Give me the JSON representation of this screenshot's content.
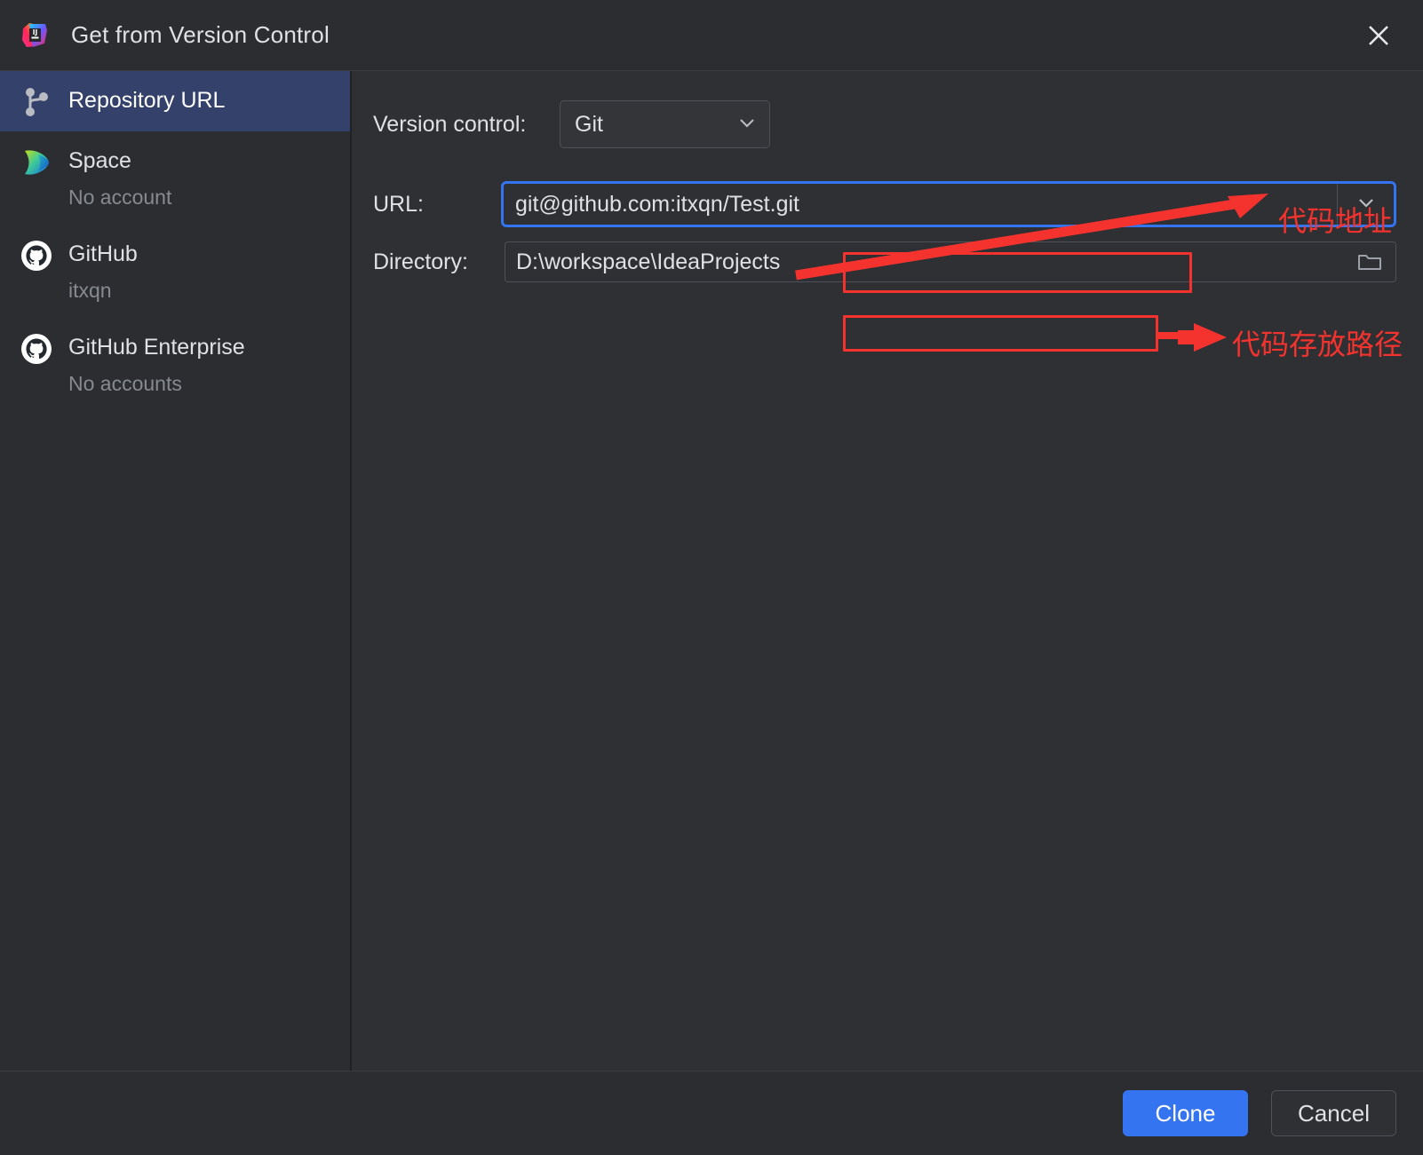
{
  "window": {
    "title": "Get from Version Control",
    "logo_icon": "intellij-idea-logo",
    "close_icon": "close-icon"
  },
  "sidebar": {
    "items": [
      {
        "label": "Repository URL",
        "sub": "",
        "icon": "git-branch-icon",
        "selected": true
      },
      {
        "label": "Space",
        "sub": "No account",
        "icon": "jetbrains-space-icon",
        "selected": false
      },
      {
        "label": "GitHub",
        "sub": "itxqn",
        "icon": "github-icon",
        "selected": false
      },
      {
        "label": "GitHub Enterprise",
        "sub": "No accounts",
        "icon": "github-icon",
        "selected": false
      }
    ]
  },
  "form": {
    "version_control": {
      "label": "Version control:",
      "value": "Git",
      "dropdown_icon": "chevron-down-icon"
    },
    "url": {
      "label": "URL:",
      "value": "git@github.com:itxqn/Test.git",
      "placeholder": "",
      "dropdown_icon": "chevron-down-icon",
      "focused": true
    },
    "directory": {
      "label": "Directory:",
      "value": "D:\\workspace\\IdeaProjects",
      "placeholder": "",
      "browse_icon": "folder-icon"
    }
  },
  "annotations": {
    "color": "#f5332e",
    "url_note": "代码地址",
    "directory_note": "代码存放路径"
  },
  "footer": {
    "clone_label": "Clone",
    "cancel_label": "Cancel"
  },
  "colors": {
    "accent": "#3574f0",
    "selection": "#34426b",
    "sidebar_bg": "#2b2d30",
    "main_bg": "#2e3033",
    "text": "#dfe1e5",
    "muted_text": "#868a91",
    "annotation_red": "#f5332e"
  }
}
